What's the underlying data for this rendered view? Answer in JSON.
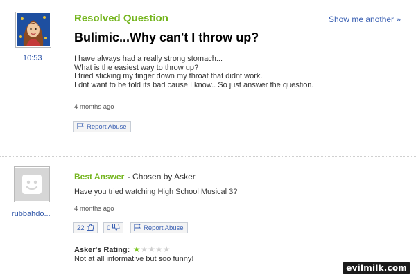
{
  "question": {
    "section_heading": "Resolved Question",
    "show_another": "Show me another »",
    "asker_name": "10:53",
    "title": "Bulimic...Why can't I throw up?",
    "body_lines": [
      "I have always had a really strong stomach...",
      "What is the easiest way to throw up?",
      "I tried sticking my finger down my throat that didnt work.",
      "I dnt want to be told its bad cause I know.. So just answer the question."
    ],
    "timestamp": "4 months ago",
    "report_label": "Report Abuse"
  },
  "answer": {
    "heading": "Best Answer",
    "chosen_by": "- Chosen by Asker",
    "answerer_name": "rubbahdo...",
    "text": "Have you tried watching High School Musical 3?",
    "timestamp": "4 months ago",
    "thumbs_up": "22",
    "thumbs_down": "0",
    "report_label": "Report Abuse",
    "rating_label": "Asker's Rating:",
    "rating_value": 1,
    "rating_max": 5,
    "rating_comment": "Not at all informative but soo funny!"
  },
  "watermark": "evilmilk.com",
  "colors": {
    "accent_green": "#74b51e",
    "link_blue": "#3a60b3"
  }
}
